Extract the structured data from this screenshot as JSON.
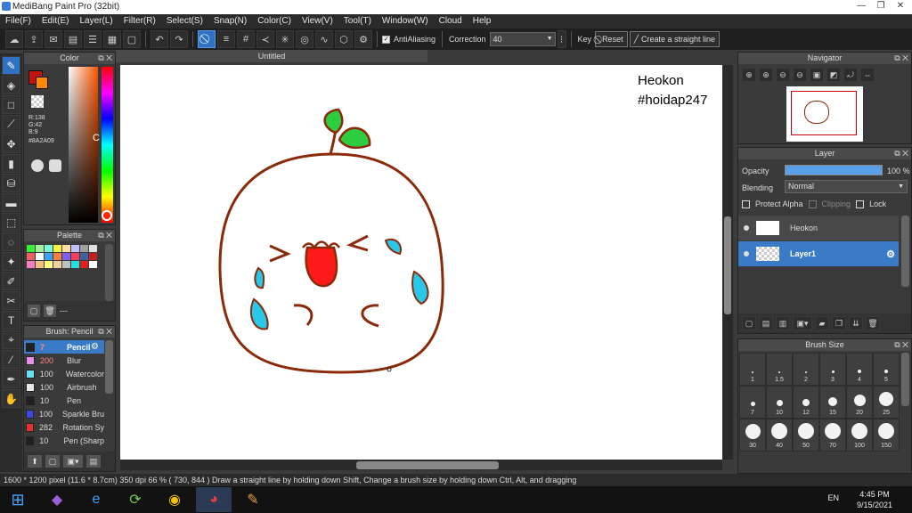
{
  "app": {
    "title": "MediBang Paint Pro (32bit)"
  },
  "menu": [
    "File(F)",
    "Edit(E)",
    "Layer(L)",
    "Filter(R)",
    "Select(S)",
    "Snap(N)",
    "Color(C)",
    "View(V)",
    "Tool(T)",
    "Window(W)",
    "Cloud",
    "Help"
  ],
  "toolbar": {
    "antialias_label": "AntiAliasing",
    "correction_label": "Correction",
    "correction_value": "40",
    "key_label": "Key",
    "reset_label": "Reset",
    "straight_line_label": "Create a straight line"
  },
  "color_panel": {
    "title": "Color",
    "r": "R:138",
    "g": "G:42",
    "b": "B:9",
    "hex": "#8A2A09",
    "cursor_letter": "C"
  },
  "palette_panel": {
    "title": "Palette",
    "label": "---"
  },
  "brush_panel": {
    "title": "Brush: Pencil",
    "items": [
      {
        "size": "7",
        "name": "Pencil",
        "color": "#202020"
      },
      {
        "size": "200",
        "name": "Blur",
        "color": "#e890e8"
      },
      {
        "size": "100",
        "name": "Watercolor",
        "color": "#67e0f0"
      },
      {
        "size": "100",
        "name": "Airbrush",
        "color": "#e8e8e8"
      },
      {
        "size": "10",
        "name": "Pen",
        "color": "#202020"
      },
      {
        "size": "100",
        "name": "Sparkle Bru",
        "color": "#3a48e0"
      },
      {
        "size": "282",
        "name": "Rotation Sy",
        "color": "#e83030"
      },
      {
        "size": "10",
        "name": "Pen (Sharp",
        "color": "#202020"
      }
    ]
  },
  "canvas": {
    "tab_title": "Untitled",
    "watermark_line1": "Heokon",
    "watermark_line2": "#hoidap247"
  },
  "navigator": {
    "title": "Navigator"
  },
  "layer_panel": {
    "title": "Layer",
    "opacity_label": "Opacity",
    "opacity_value": "100 %",
    "blending_label": "Blending",
    "blending_value": "Normal",
    "protect_alpha": "Protect Alpha",
    "clipping": "Clipping",
    "lock": "Lock",
    "layers": [
      {
        "name": "Heokon"
      },
      {
        "name": "Layer1"
      }
    ]
  },
  "brush_size_panel": {
    "title": "Brush Size",
    "sizes": [
      "1",
      "1.5",
      "2",
      "3",
      "4",
      "5",
      "7",
      "10",
      "12",
      "15",
      "20",
      "25",
      "30",
      "40",
      "50",
      "70",
      "100",
      "150"
    ]
  },
  "status": {
    "text": "1600 * 1200 pixel   (11.6 * 8.7cm)   350 dpi   66 %   ( 730, 844 )   Draw a straight line by holding down Shift, Change a brush size by holding down Ctrl, Alt, and dragging"
  },
  "taskbar": {
    "lang": "EN",
    "time": "4:45 PM",
    "date": "9/15/2021"
  },
  "colors": {
    "accent": "#3a7bc8",
    "fg_color": "#8A2A09",
    "drawing_stroke": "#8A2A09",
    "leaf": "#2ecc40",
    "tongue": "#ff1a1a",
    "tear": "#29c7e8"
  }
}
